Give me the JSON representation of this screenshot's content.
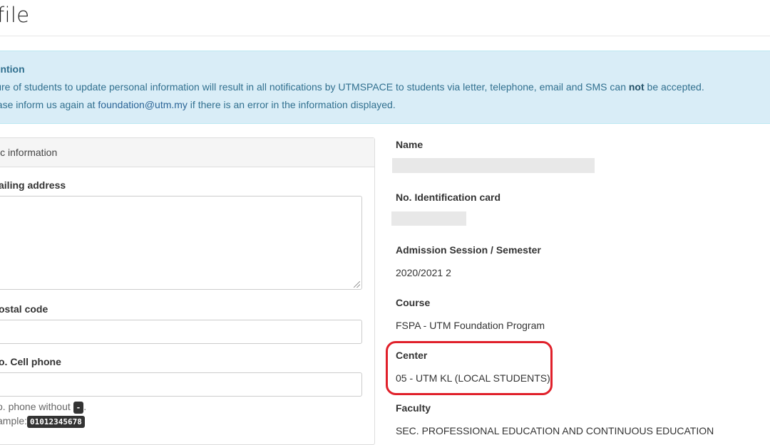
{
  "page": {
    "title": "ofile"
  },
  "alert": {
    "heading": "tention",
    "line1_before": "ilure of students to update personal information will result in all notifications by UTMSPACE to students via letter, telephone, email and SMS can ",
    "line1_bold": "not",
    "line1_after": " be accepted.",
    "line2_before": "ease inform us again at ",
    "line2_link": "foundation@utm.my",
    "line2_after": " if there is an error in the information displayed."
  },
  "form": {
    "panel_heading": "sic information",
    "mailing_label": "ailing address",
    "mailing_value": "",
    "postal_label": "ostal code",
    "postal_value": "",
    "phone_label": "o. Cell phone",
    "phone_value": "",
    "help_line1": "o. phone without",
    "help_code1": "-",
    "help_line1_end": ".",
    "help_line2": "ample:",
    "help_code2": "01012345678"
  },
  "profile": {
    "name_label": "Name",
    "ic_label": "No. Identification card",
    "session_label": "Admission Session / Semester",
    "session_value": "2020/2021 2",
    "course_label": "Course",
    "course_value": "FSPA - UTM Foundation Program",
    "center_label": "Center",
    "center_value": "05 - UTM KL (LOCAL STUDENTS)",
    "faculty_label": "Faculty",
    "faculty_value": "SEC. PROFESSIONAL EDUCATION AND CONTINUOUS EDUCATION"
  },
  "colors": {
    "alert_bg": "#d9edf7",
    "alert_text": "#31708f",
    "highlight": "#e0202a"
  }
}
